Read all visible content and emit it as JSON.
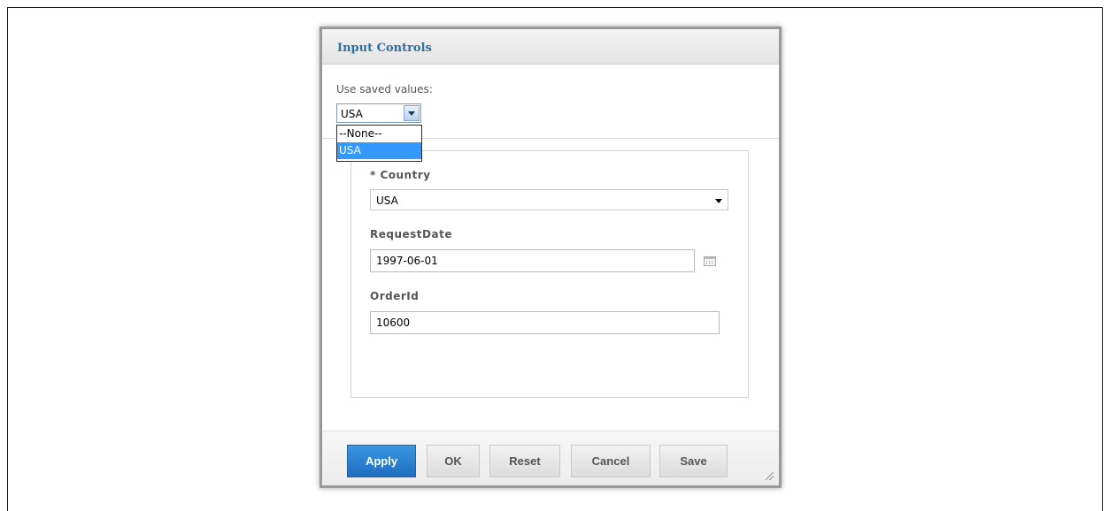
{
  "dialog": {
    "title": "Input Controls",
    "saved_values": {
      "label": "Use saved values:",
      "selected": "USA",
      "options": [
        "--None--",
        "USA"
      ],
      "highlighted_option": "USA"
    },
    "controls": {
      "country": {
        "label": "* Country",
        "value": "USA"
      },
      "request_date": {
        "label": "RequestDate",
        "value": "1997-06-01"
      },
      "order_id": {
        "label": "OrderId",
        "value": "10600"
      }
    },
    "buttons": {
      "apply": "Apply",
      "ok": "OK",
      "reset": "Reset",
      "cancel": "Cancel",
      "save": "Save"
    }
  },
  "colors": {
    "title": "#2f6fa6",
    "primary_button": "#2a82d4",
    "selected_option": "#3399ff"
  },
  "icons": {
    "dropdown": "chevron-down-icon",
    "calendar": "calendar-icon",
    "resize": "resize-grip-icon"
  }
}
